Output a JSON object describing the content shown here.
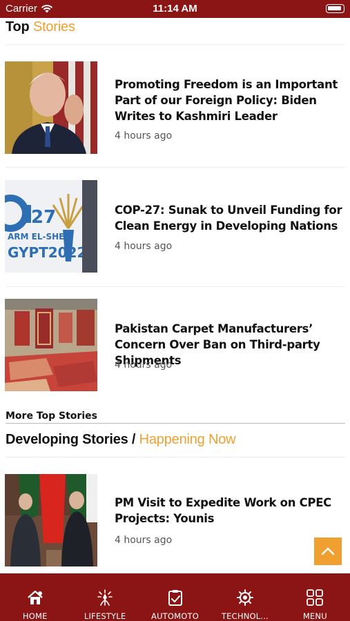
{
  "status_bar": {
    "carrier": "Carrier",
    "time": "11:14 AM"
  },
  "top_stories": {
    "title": "Top",
    "title_accent": "Stories",
    "items": [
      {
        "headline": "Promoting Freedom is an Important Part of our Foreign Policy: Biden Writes to Kashmiri Leader",
        "time": "4 hours ago"
      },
      {
        "headline": "COP-27: Sunak to Unveil Funding for Clean Energy in Developing Nations",
        "time": "4 hours ago"
      },
      {
        "headline": "Pakistan Carpet Manufacturers’ Concern Over Ban on Third-party Shipments",
        "time": "4 hours ago"
      }
    ],
    "more_label": "More Top Stories"
  },
  "developing": {
    "title": "Developing Stories /",
    "title_accent": "Happening Now",
    "items": [
      {
        "headline": "PM Visit to Expedite Work on CPEC Projects: Younis",
        "time": "4 hours ago"
      }
    ]
  },
  "bottom_nav": [
    {
      "label": "HOME",
      "icon": "home-icon"
    },
    {
      "label": "LIFESTYLE",
      "icon": "lifestyle-icon"
    },
    {
      "label": "AUTOMOTO",
      "icon": "automoto-icon"
    },
    {
      "label": "TECHNOL...",
      "icon": "technology-icon"
    },
    {
      "label": "MENU",
      "icon": "menu-grid-icon"
    }
  ],
  "colors": {
    "brand": "#8b1515",
    "accent": "#f0a030"
  }
}
